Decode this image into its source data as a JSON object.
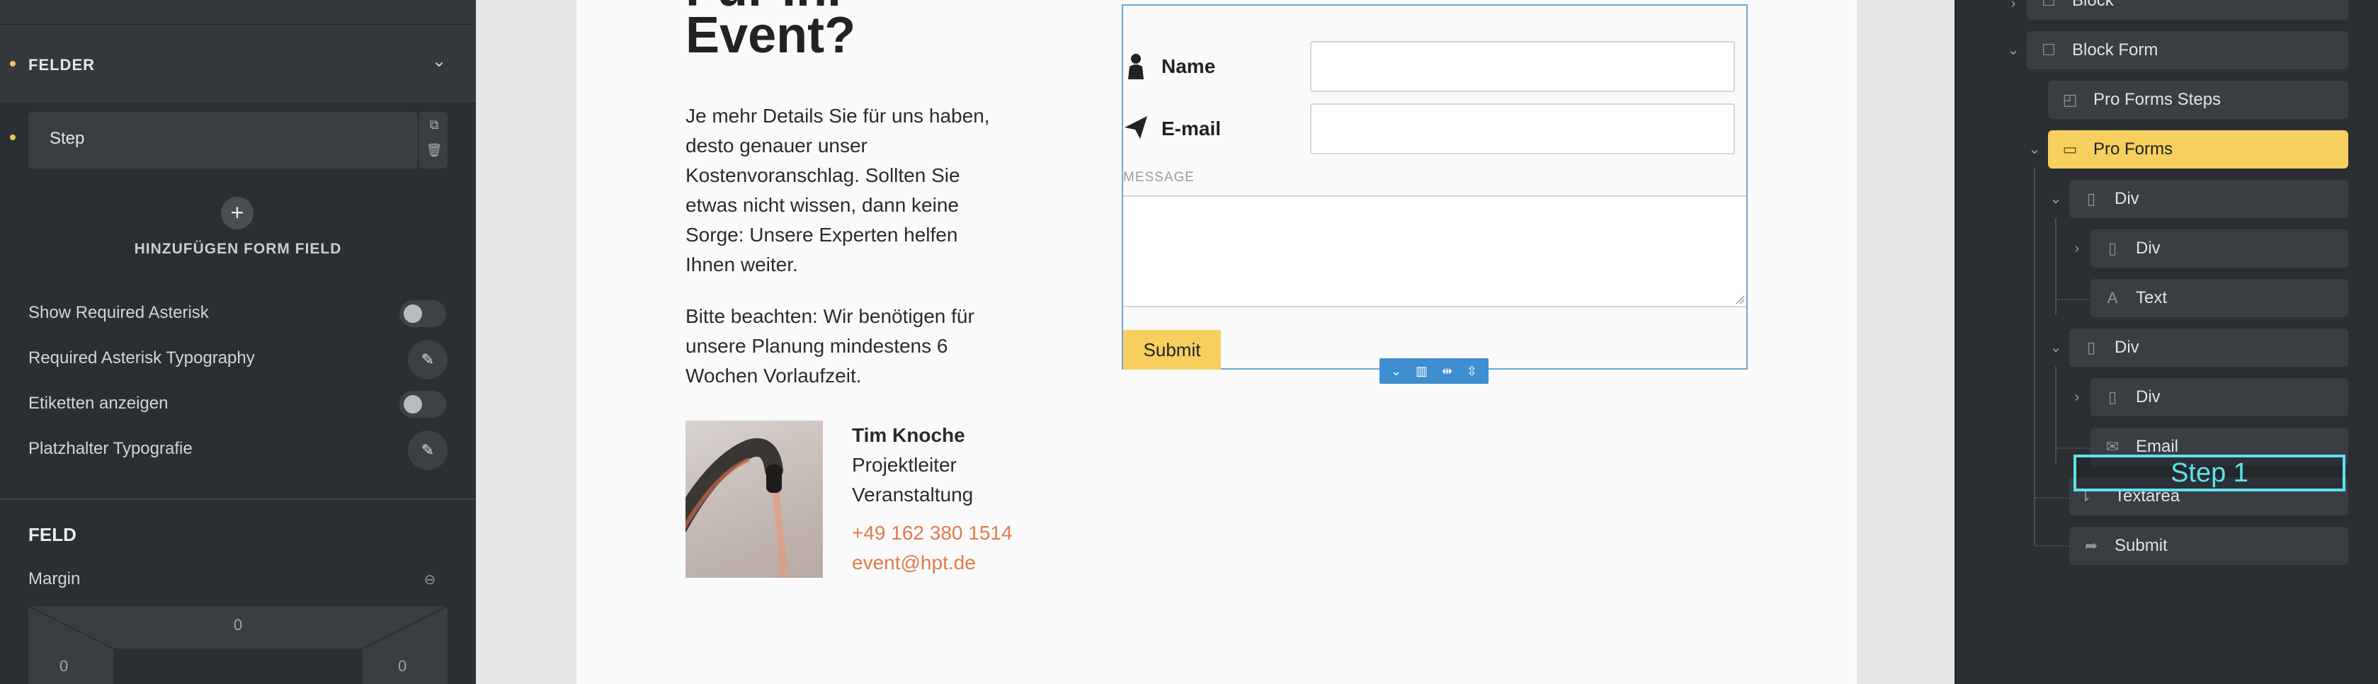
{
  "left_panel": {
    "felder_title": "FELDER",
    "step_label": "Step",
    "add_field_label": "HINZUFÜGEN FORM FIELD",
    "options": [
      {
        "label": "Show Required Asterisk",
        "control": "toggle"
      },
      {
        "label": "Required Asterisk Typography",
        "control": "edit"
      },
      {
        "label": "Etiketten anzeigen",
        "control": "toggle"
      },
      {
        "label": "Platzhalter Typografie",
        "control": "edit"
      }
    ],
    "feld_title": "FELD",
    "margin_label": "Margin",
    "margin_values": {
      "top": "0",
      "left": "0",
      "right": "0"
    }
  },
  "canvas": {
    "heading_prev": "Für Ihr",
    "heading": "Event?",
    "paragraph1": "Je mehr Details Sie für uns haben, desto genauer unser Kostenvoranschlag. Sollten Sie etwas nicht wissen, dann keine Sorge: Unsere Experten helfen Ihnen weiter.",
    "paragraph2": "Bitte beachten: Wir benötigen für unsere Planung mindestens 6 Wochen Vorlaufzeit.",
    "contact": {
      "name": "Tim Knoche",
      "role_line1": "Projektleiter",
      "role_line2": "Veranstaltung",
      "phone": "+49 162 380 1514",
      "email": "event@hpt.de"
    },
    "form": {
      "name_label": "Name",
      "email_label": "E-mail",
      "message_label": "MESSAGE",
      "submit_label": "Submit"
    }
  },
  "right_panel": {
    "nodes": {
      "block": "Block",
      "block_form": "Block Form",
      "pro_forms_steps": "Pro Forms Steps",
      "pro_forms": "Pro Forms",
      "div1": "Div",
      "div1_child": "Div",
      "text": "Text",
      "div2": "Div",
      "div2_child": "Div",
      "email": "Email",
      "textarea": "Textarea",
      "submit": "Submit"
    },
    "drag_overlay": "Step 1"
  },
  "colors": {
    "accent": "#f6cf5e",
    "selection_blue": "#6aa7d6",
    "link_orange": "#e07b4c",
    "overlay_cyan": "#5fe3e6",
    "panel_bg": "#2b2e32"
  }
}
